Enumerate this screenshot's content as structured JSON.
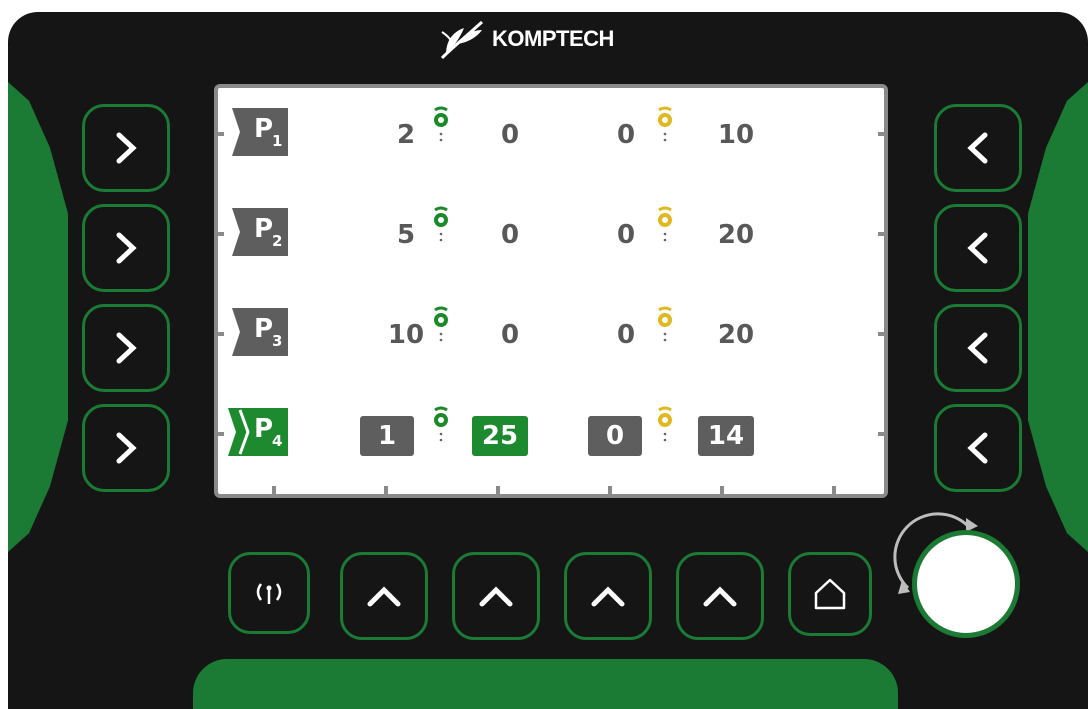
{
  "brand": {
    "name": "KOMPTECH"
  },
  "colors": {
    "green": "#1b7a33",
    "active_green": "#1e8a2f",
    "gray": "#5e5e5e",
    "yellow": "#e0b820"
  },
  "rows": [
    {
      "tab": "P",
      "sub": "1",
      "v1": "2",
      "v2": "0",
      "v3": "0",
      "v4": "10",
      "active": false
    },
    {
      "tab": "P",
      "sub": "2",
      "v1": "5",
      "v2": "0",
      "v3": "0",
      "v4": "20",
      "active": false
    },
    {
      "tab": "P",
      "sub": "3",
      "v1": "10",
      "v2": "0",
      "v3": "0",
      "v4": "20",
      "active": false
    },
    {
      "tab": "P",
      "sub": "4",
      "v1": "1",
      "v2": "25",
      "v3": "0",
      "v4": "14",
      "active": true
    }
  ],
  "icons": {
    "left_buttons": "chevron-right-icon",
    "right_buttons": "chevron-left-icon",
    "bottom_buttons": [
      "antenna-icon",
      "chevron-up-icon",
      "chevron-up-icon",
      "chevron-up-icon",
      "chevron-up-icon",
      "home-icon"
    ],
    "gear_green": "gear-green-icon",
    "gear_yellow": "gear-yellow-icon"
  },
  "bottom_bar": {
    "antenna_glyph": "(ᵢ)"
  }
}
